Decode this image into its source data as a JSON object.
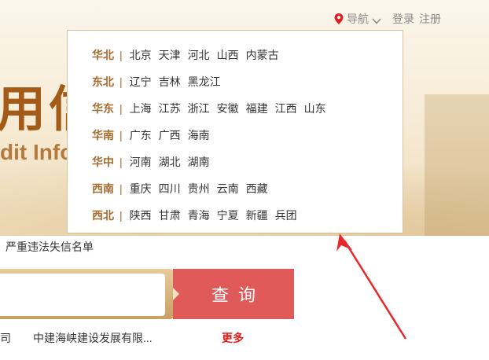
{
  "header": {
    "title_partial": "用信",
    "subtitle_partial": "dit Info",
    "nav_label": "导航",
    "login": "登录",
    "register": "注册"
  },
  "regions": [
    {
      "name": "华北",
      "provinces": [
        "北京",
        "天津",
        "河北",
        "山西",
        "内蒙古"
      ]
    },
    {
      "name": "东北",
      "provinces": [
        "辽宁",
        "吉林",
        "黑龙江"
      ]
    },
    {
      "name": "华东",
      "provinces": [
        "上海",
        "江苏",
        "浙江",
        "安徽",
        "福建",
        "江西",
        "山东"
      ]
    },
    {
      "name": "华南",
      "provinces": [
        "广东",
        "广西",
        "海南"
      ]
    },
    {
      "name": "华中",
      "provinces": [
        "河南",
        "湖北",
        "湖南"
      ]
    },
    {
      "name": "西南",
      "provinces": [
        "重庆",
        "四川",
        "贵州",
        "云南",
        "西藏"
      ]
    },
    {
      "name": "西北",
      "provinces": [
        "陕西",
        "甘肃",
        "青海",
        "宁夏",
        "新疆",
        "兵团"
      ]
    }
  ],
  "separator": "|",
  "blacklist_link": "严重违法失信名单",
  "search": {
    "value": "",
    "button_label": "查询"
  },
  "hot_items": [
    "司",
    "中建海峡建设发展有限..."
  ],
  "more_link": "更多",
  "colors": {
    "brand": "#a35b17",
    "region": "#a56a2e",
    "search_button": "#e05a5a",
    "annotation_arrow": "#e8282b"
  },
  "icons": {
    "location": "location-pin-icon",
    "dropdown": "chevron-down-icon"
  }
}
